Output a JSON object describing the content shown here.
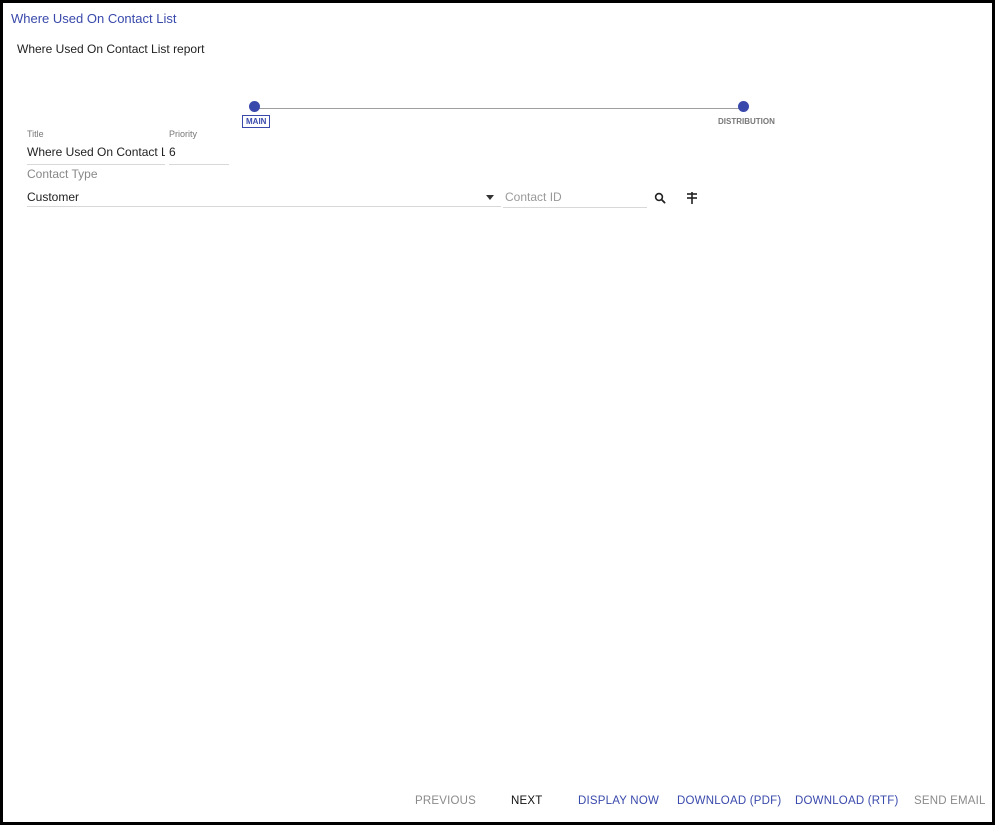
{
  "dialog": {
    "title": "Where Used On Contact List",
    "subtitle": "Where Used On Contact List report"
  },
  "stepper": {
    "steps": [
      {
        "label": "MAIN",
        "active": true
      },
      {
        "label": "DISTRIBUTION",
        "active": false
      }
    ],
    "accent_color": "#3949ab"
  },
  "form": {
    "title_label": "Title",
    "title_value": "Where Used On Contact List",
    "priority_label": "Priority",
    "priority_value": "6",
    "contact_type_label": "Contact Type",
    "contact_type_value": "Customer",
    "contact_id_placeholder": "Contact ID",
    "contact_id_value": "",
    "search_icon": "search-icon",
    "filter_icon": "filter-icon"
  },
  "footer": {
    "previous_label": "PREVIOUS",
    "next_label": "NEXT",
    "display_now_label": "DISPLAY NOW",
    "download_pdf_label": "DOWNLOAD (PDF)",
    "download_rtf_label": "DOWNLOAD (RTF)",
    "send_email_label": "SEND EMAIL"
  }
}
